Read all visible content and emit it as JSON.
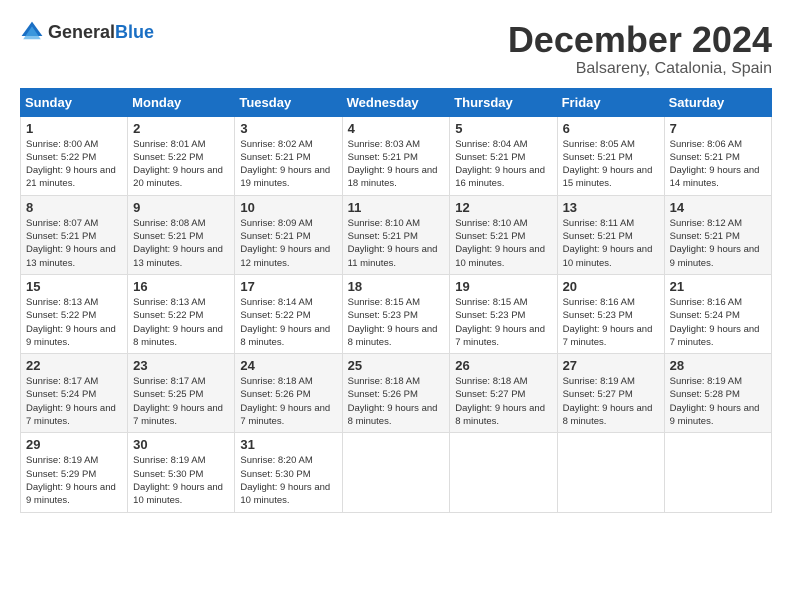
{
  "logo": {
    "text_general": "General",
    "text_blue": "Blue"
  },
  "title": "December 2024",
  "subtitle": "Balsareny, Catalonia, Spain",
  "weekdays": [
    "Sunday",
    "Monday",
    "Tuesday",
    "Wednesday",
    "Thursday",
    "Friday",
    "Saturday"
  ],
  "weeks": [
    [
      {
        "day": "1",
        "sunrise": "Sunrise: 8:00 AM",
        "sunset": "Sunset: 5:22 PM",
        "daylight": "Daylight: 9 hours and 21 minutes."
      },
      {
        "day": "2",
        "sunrise": "Sunrise: 8:01 AM",
        "sunset": "Sunset: 5:22 PM",
        "daylight": "Daylight: 9 hours and 20 minutes."
      },
      {
        "day": "3",
        "sunrise": "Sunrise: 8:02 AM",
        "sunset": "Sunset: 5:21 PM",
        "daylight": "Daylight: 9 hours and 19 minutes."
      },
      {
        "day": "4",
        "sunrise": "Sunrise: 8:03 AM",
        "sunset": "Sunset: 5:21 PM",
        "daylight": "Daylight: 9 hours and 18 minutes."
      },
      {
        "day": "5",
        "sunrise": "Sunrise: 8:04 AM",
        "sunset": "Sunset: 5:21 PM",
        "daylight": "Daylight: 9 hours and 16 minutes."
      },
      {
        "day": "6",
        "sunrise": "Sunrise: 8:05 AM",
        "sunset": "Sunset: 5:21 PM",
        "daylight": "Daylight: 9 hours and 15 minutes."
      },
      {
        "day": "7",
        "sunrise": "Sunrise: 8:06 AM",
        "sunset": "Sunset: 5:21 PM",
        "daylight": "Daylight: 9 hours and 14 minutes."
      }
    ],
    [
      {
        "day": "8",
        "sunrise": "Sunrise: 8:07 AM",
        "sunset": "Sunset: 5:21 PM",
        "daylight": "Daylight: 9 hours and 13 minutes."
      },
      {
        "day": "9",
        "sunrise": "Sunrise: 8:08 AM",
        "sunset": "Sunset: 5:21 PM",
        "daylight": "Daylight: 9 hours and 13 minutes."
      },
      {
        "day": "10",
        "sunrise": "Sunrise: 8:09 AM",
        "sunset": "Sunset: 5:21 PM",
        "daylight": "Daylight: 9 hours and 12 minutes."
      },
      {
        "day": "11",
        "sunrise": "Sunrise: 8:10 AM",
        "sunset": "Sunset: 5:21 PM",
        "daylight": "Daylight: 9 hours and 11 minutes."
      },
      {
        "day": "12",
        "sunrise": "Sunrise: 8:10 AM",
        "sunset": "Sunset: 5:21 PM",
        "daylight": "Daylight: 9 hours and 10 minutes."
      },
      {
        "day": "13",
        "sunrise": "Sunrise: 8:11 AM",
        "sunset": "Sunset: 5:21 PM",
        "daylight": "Daylight: 9 hours and 10 minutes."
      },
      {
        "day": "14",
        "sunrise": "Sunrise: 8:12 AM",
        "sunset": "Sunset: 5:21 PM",
        "daylight": "Daylight: 9 hours and 9 minutes."
      }
    ],
    [
      {
        "day": "15",
        "sunrise": "Sunrise: 8:13 AM",
        "sunset": "Sunset: 5:22 PM",
        "daylight": "Daylight: 9 hours and 9 minutes."
      },
      {
        "day": "16",
        "sunrise": "Sunrise: 8:13 AM",
        "sunset": "Sunset: 5:22 PM",
        "daylight": "Daylight: 9 hours and 8 minutes."
      },
      {
        "day": "17",
        "sunrise": "Sunrise: 8:14 AM",
        "sunset": "Sunset: 5:22 PM",
        "daylight": "Daylight: 9 hours and 8 minutes."
      },
      {
        "day": "18",
        "sunrise": "Sunrise: 8:15 AM",
        "sunset": "Sunset: 5:23 PM",
        "daylight": "Daylight: 9 hours and 8 minutes."
      },
      {
        "day": "19",
        "sunrise": "Sunrise: 8:15 AM",
        "sunset": "Sunset: 5:23 PM",
        "daylight": "Daylight: 9 hours and 7 minutes."
      },
      {
        "day": "20",
        "sunrise": "Sunrise: 8:16 AM",
        "sunset": "Sunset: 5:23 PM",
        "daylight": "Daylight: 9 hours and 7 minutes."
      },
      {
        "day": "21",
        "sunrise": "Sunrise: 8:16 AM",
        "sunset": "Sunset: 5:24 PM",
        "daylight": "Daylight: 9 hours and 7 minutes."
      }
    ],
    [
      {
        "day": "22",
        "sunrise": "Sunrise: 8:17 AM",
        "sunset": "Sunset: 5:24 PM",
        "daylight": "Daylight: 9 hours and 7 minutes."
      },
      {
        "day": "23",
        "sunrise": "Sunrise: 8:17 AM",
        "sunset": "Sunset: 5:25 PM",
        "daylight": "Daylight: 9 hours and 7 minutes."
      },
      {
        "day": "24",
        "sunrise": "Sunrise: 8:18 AM",
        "sunset": "Sunset: 5:26 PM",
        "daylight": "Daylight: 9 hours and 7 minutes."
      },
      {
        "day": "25",
        "sunrise": "Sunrise: 8:18 AM",
        "sunset": "Sunset: 5:26 PM",
        "daylight": "Daylight: 9 hours and 8 minutes."
      },
      {
        "day": "26",
        "sunrise": "Sunrise: 8:18 AM",
        "sunset": "Sunset: 5:27 PM",
        "daylight": "Daylight: 9 hours and 8 minutes."
      },
      {
        "day": "27",
        "sunrise": "Sunrise: 8:19 AM",
        "sunset": "Sunset: 5:27 PM",
        "daylight": "Daylight: 9 hours and 8 minutes."
      },
      {
        "day": "28",
        "sunrise": "Sunrise: 8:19 AM",
        "sunset": "Sunset: 5:28 PM",
        "daylight": "Daylight: 9 hours and 9 minutes."
      }
    ],
    [
      {
        "day": "29",
        "sunrise": "Sunrise: 8:19 AM",
        "sunset": "Sunset: 5:29 PM",
        "daylight": "Daylight: 9 hours and 9 minutes."
      },
      {
        "day": "30",
        "sunrise": "Sunrise: 8:19 AM",
        "sunset": "Sunset: 5:30 PM",
        "daylight": "Daylight: 9 hours and 10 minutes."
      },
      {
        "day": "31",
        "sunrise": "Sunrise: 8:20 AM",
        "sunset": "Sunset: 5:30 PM",
        "daylight": "Daylight: 9 hours and 10 minutes."
      },
      null,
      null,
      null,
      null
    ]
  ]
}
